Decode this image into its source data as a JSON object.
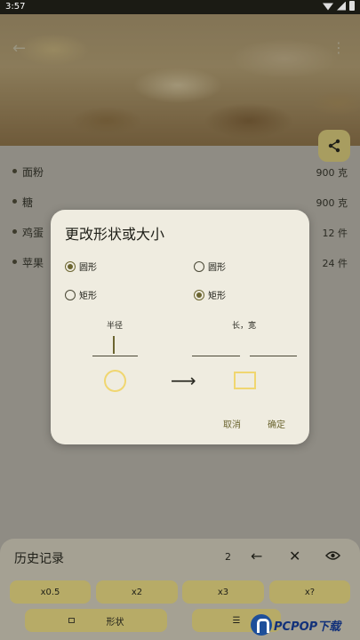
{
  "status_bar": {
    "time": "3:57"
  },
  "hero": {
    "back_icon": "arrow-left-icon",
    "more_icon": "more-vert-icon"
  },
  "share_icon": "share-icon",
  "ingredients": [
    {
      "name": "面粉",
      "qty": "900 克"
    },
    {
      "name": "糖",
      "qty": "900 克"
    },
    {
      "name": "鸡蛋",
      "qty": "12 件"
    },
    {
      "name": "苹果",
      "qty": "24 件"
    }
  ],
  "dialog": {
    "title": "更改形状或大小",
    "left_options": [
      {
        "label": "圆形",
        "selected": true
      },
      {
        "label": "矩形",
        "selected": false
      }
    ],
    "right_options": [
      {
        "label": "圆形",
        "selected": false
      },
      {
        "label": "矩形",
        "selected": true
      }
    ],
    "left_field_label": "半径",
    "right_field_label": "长，宽",
    "arrow": "⟶",
    "cancel": "取消",
    "ok": "确定",
    "accent": "#6b6530",
    "shape_color": "#f0d670"
  },
  "history": {
    "title": "历史记录",
    "count": "2",
    "back_icon": "arrow-left-icon",
    "close_icon": "close-icon",
    "eye_icon": "eye-icon"
  },
  "multipliers": [
    "x0.5",
    "x2",
    "x3",
    "x?"
  ],
  "shape_button": "形状",
  "watermark": "PCPOP下载"
}
